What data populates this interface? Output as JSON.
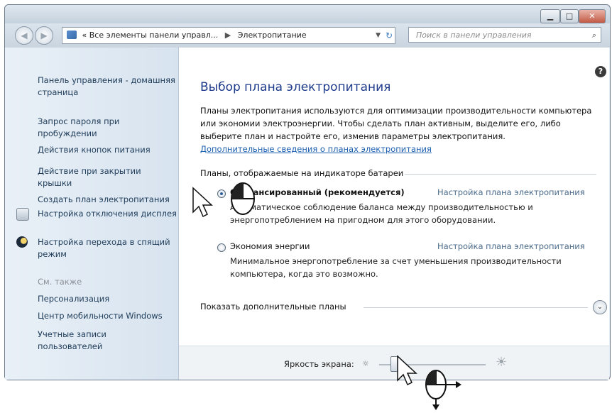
{
  "window": {
    "controls": {
      "minimize": "▁",
      "maximize": "□",
      "close": "✕"
    }
  },
  "nav": {
    "back_icon": "back-arrow-icon",
    "forward_icon": "forward-arrow-icon",
    "address_prefix": "«",
    "address_part1": "Все элементы панели управл...",
    "address_sep": "▶",
    "address_part2": "Электропитание",
    "search_placeholder": "Поиск в панели управления"
  },
  "sidebar": {
    "items": [
      {
        "label": "Панель управления - домашняя страница"
      },
      {
        "label": "Запрос пароля при пробуждении"
      },
      {
        "label": "Действия кнопок питания"
      },
      {
        "label": "Действие при закрытии крышки"
      },
      {
        "label": "Создать план электропитания"
      },
      {
        "label": "Настройка отключения дисплея"
      },
      {
        "label": "Настройка перехода в спящий режим"
      }
    ],
    "see_also": "См. также",
    "see_also_items": [
      {
        "label": "Персонализация"
      },
      {
        "label": "Центр мобильности Windows"
      },
      {
        "label": "Учетные записи пользователей"
      }
    ]
  },
  "main": {
    "title": "Выбор плана электропитания",
    "description": "Планы электропитания используются для оптимизации производительности компьютера или экономии электроэнергии. Чтобы сделать план активным, выделите его, либо выберите план и настройте его, изменив параметры электропитания.",
    "more_link": "Дополнительные сведения о планах электропитания",
    "group_label": "Планы, отображаемые на индикаторе батареи",
    "plans": [
      {
        "name": "Сбалансированный (рекомендуется)",
        "settings_link": "Настройка плана электропитания",
        "description": "Автоматическое соблюдение баланса между производительностью и энергопотреблением на пригодном для этого оборудовании.",
        "selected": true
      },
      {
        "name": "Экономия энергии",
        "settings_link": "Настройка плана электропитания",
        "description": "Минимальное энергопотребление за счет уменьшения производительности компьютера, когда это возможно.",
        "selected": false
      }
    ],
    "show_more": "Показать дополнительные планы",
    "brightness_label": "Яркость экрана:",
    "brightness_level_percent": 10
  },
  "colors": {
    "title_blue": "#1e3a8a",
    "link_blue": "#1d5fb0"
  }
}
